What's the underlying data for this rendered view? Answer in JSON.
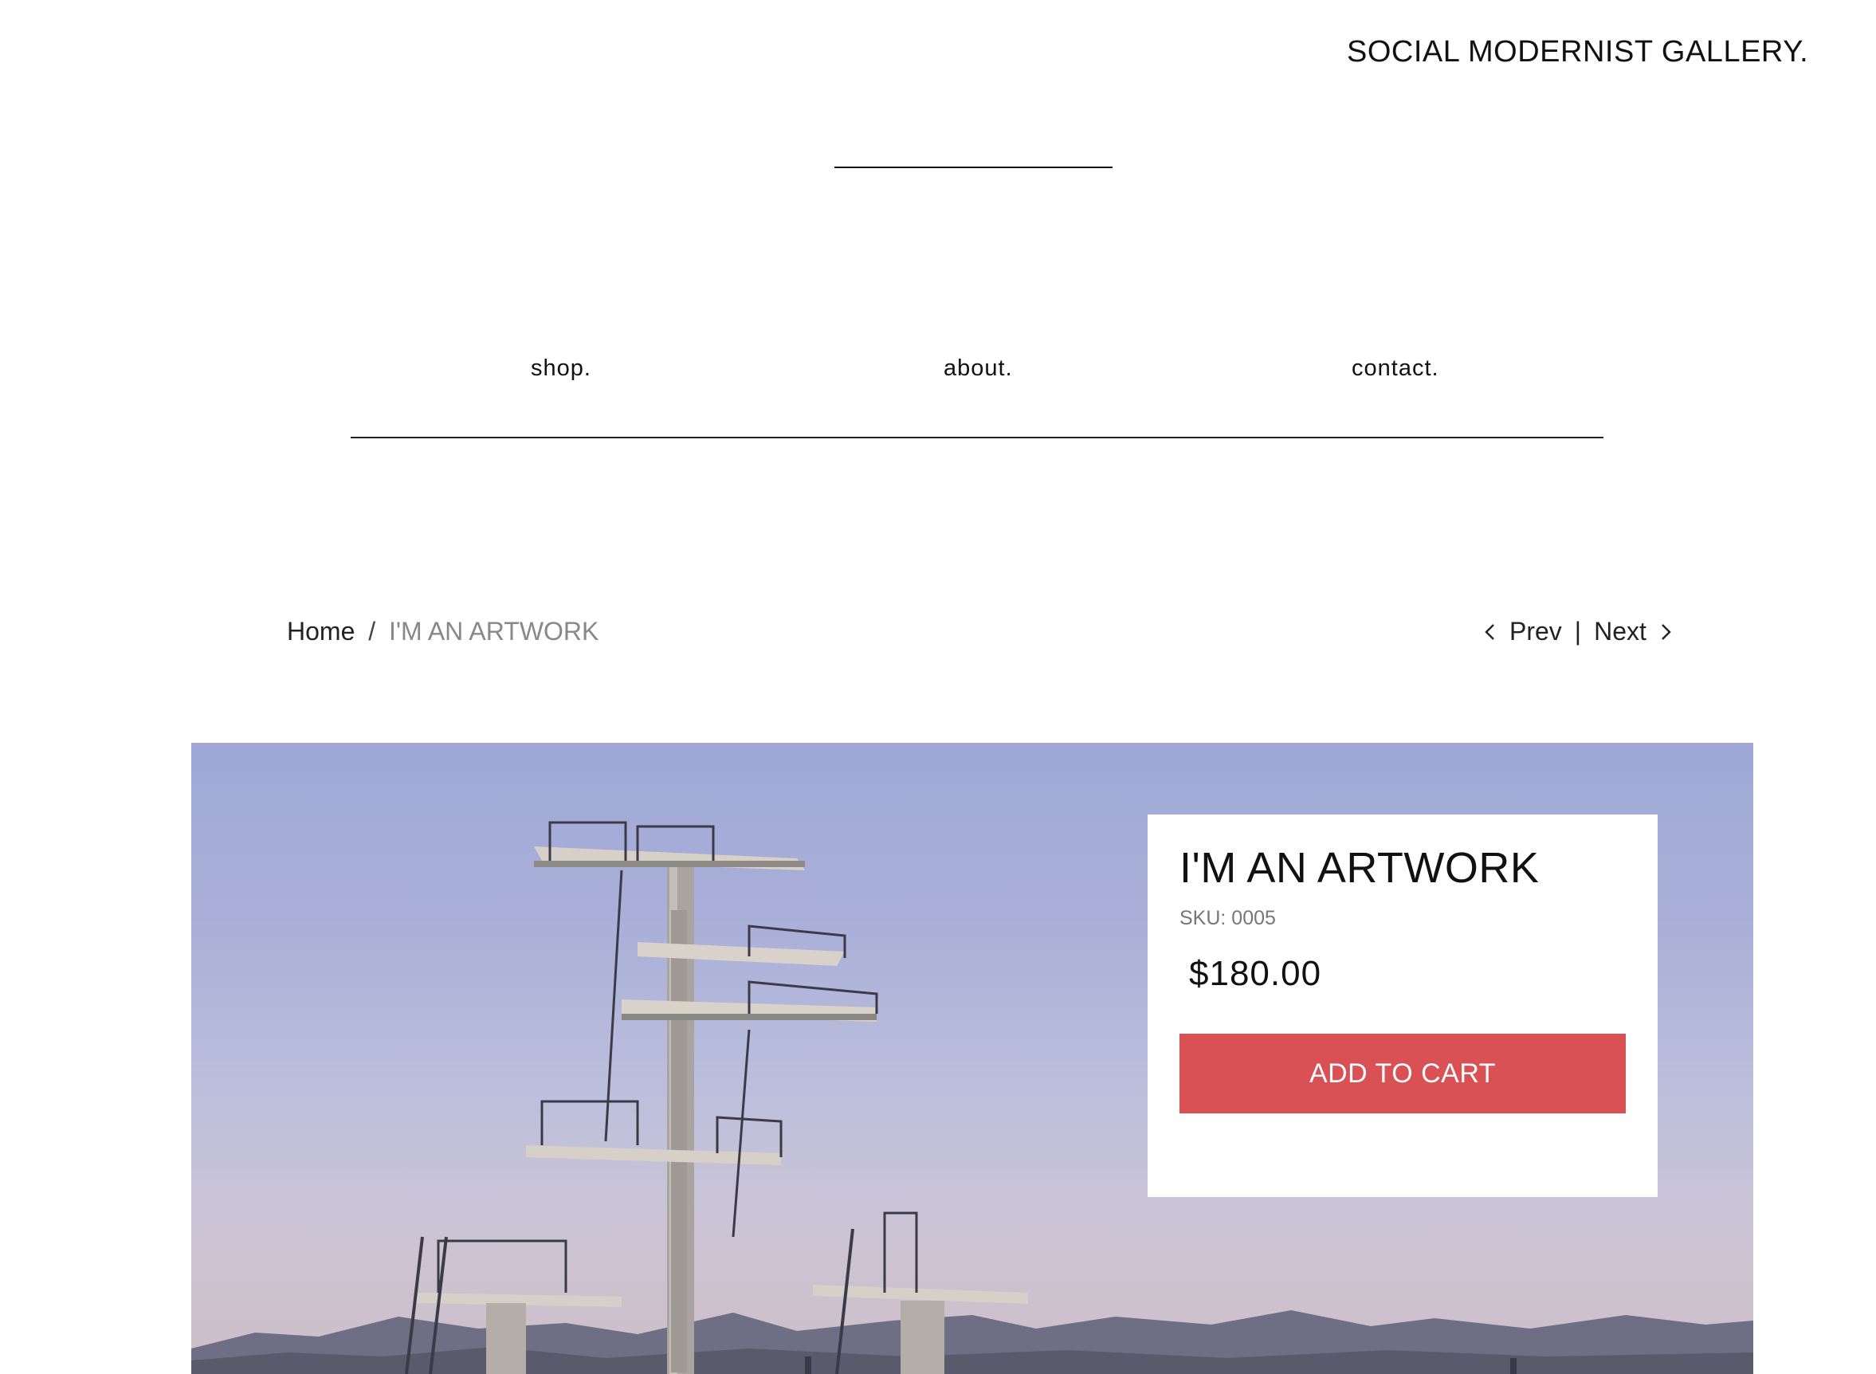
{
  "header": {
    "brand": "SOCIAL MODERNIST GALLERY."
  },
  "nav": {
    "items": [
      {
        "label": "shop."
      },
      {
        "label": "about."
      },
      {
        "label": "contact."
      }
    ]
  },
  "breadcrumb": {
    "home": "Home",
    "separator": "/",
    "current": "I'M AN ARTWORK"
  },
  "pager": {
    "prev": "Prev",
    "divider": "|",
    "next": "Next"
  },
  "product": {
    "title": "I'M AN ARTWORK",
    "sku": "SKU: 0005",
    "price": "$180.00",
    "add_to_cart": "ADD TO CART"
  },
  "colors": {
    "accent": "#d95055",
    "text": "#111111",
    "muted": "#888888"
  }
}
